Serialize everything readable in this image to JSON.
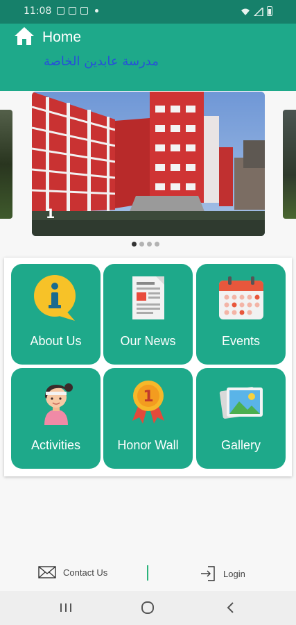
{
  "status_bar": {
    "time": "11:08"
  },
  "header": {
    "title": "Home",
    "subtitle": "مدرسة عابدين الخاصة"
  },
  "carousel": {
    "current_number": "1",
    "page_count": 4,
    "active_index": 0
  },
  "tiles": [
    {
      "label": "About Us",
      "icon": "info-bubble-icon"
    },
    {
      "label": "Our News",
      "icon": "newspaper-icon"
    },
    {
      "label": "Events",
      "icon": "calendar-icon"
    },
    {
      "label": "Activities",
      "icon": "student-girl-icon"
    },
    {
      "label": "Honor Wall",
      "icon": "medal-icon"
    },
    {
      "label": "Gallery",
      "icon": "photo-gallery-icon"
    }
  ],
  "footer": {
    "contact_label": "Contact Us",
    "login_label": "Login"
  },
  "colors": {
    "primary": "#1ea98a",
    "status_bar": "#16806a",
    "subtitle": "#2750d8"
  }
}
